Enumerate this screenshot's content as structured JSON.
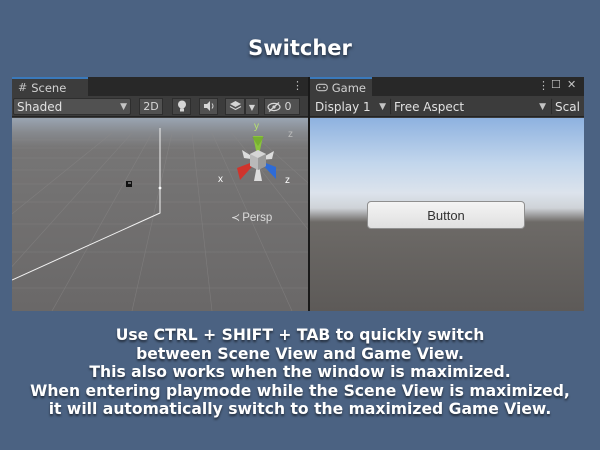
{
  "title": "Switcher",
  "scene": {
    "tab_label": "Scene",
    "tab_icon": "#",
    "shading_mode": "Shaded",
    "btn_2d": "2D",
    "hidden_count": "0",
    "persp_label": "Persp",
    "gizmo_y": "y",
    "gizmo_x": "x",
    "gizmo_z": "z"
  },
  "game": {
    "tab_label": "Game",
    "display": "Display 1",
    "aspect": "Free Aspect",
    "scale_label": "Scal",
    "button_label": "Button"
  },
  "caption": [
    "Use CTRL + SHIFT + TAB to quickly switch",
    "between Scene View and Game View.",
    "This also works when the window is maximized.",
    "When entering playmode while the Scene View is maximized,",
    "it will automatically switch to the maximized Game View."
  ],
  "colors": {
    "background": "#4b6282",
    "tab_accent": "#3a79bb",
    "gizmo_x": "#d0342c",
    "gizmo_y": "#8ac43c",
    "gizmo_z": "#2e6bd6"
  },
  "icons": {
    "scene_tab": "grid-icon",
    "game_tab": "gamepad-icon",
    "light": "lightbulb-icon",
    "audio": "speaker-icon",
    "effects": "effects-icon",
    "visibility": "eye-slash-icon"
  }
}
